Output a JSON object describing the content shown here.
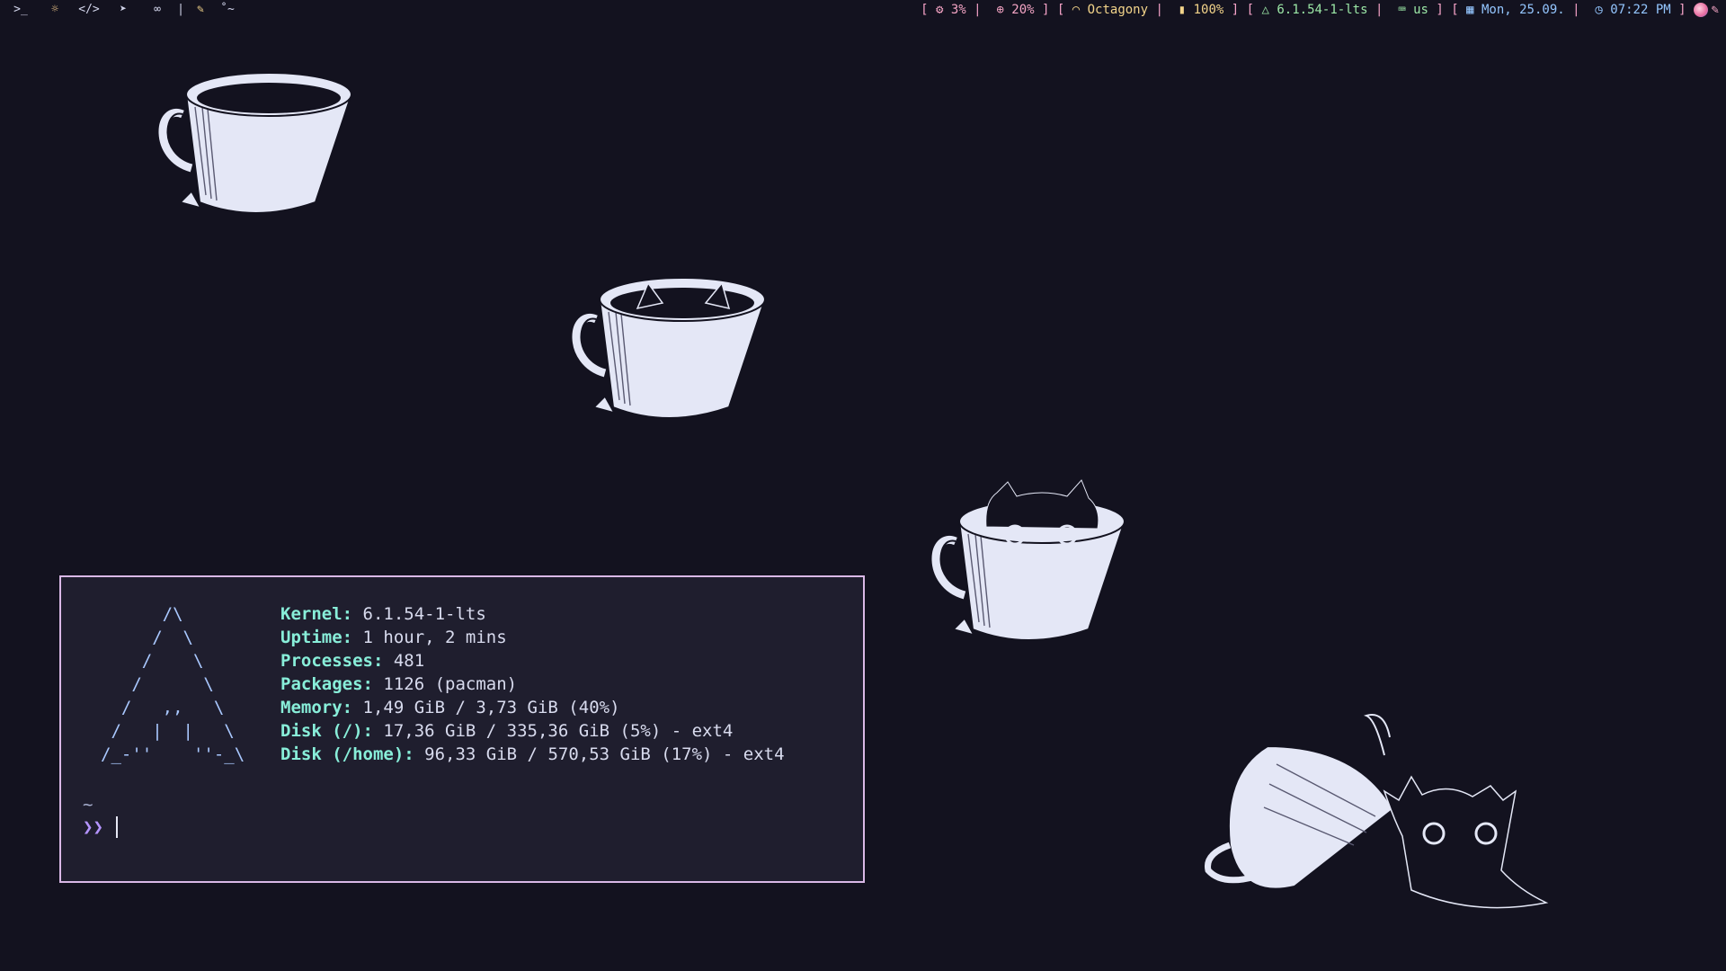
{
  "topbar": {
    "workspaces": [
      {
        "icon": "terminal-icon",
        "glyph": ">_",
        "active": false
      },
      {
        "icon": "firefox-icon",
        "glyph": "☼",
        "active": true
      },
      {
        "icon": "code-icon",
        "glyph": "</>",
        "active": false
      },
      {
        "icon": "telegram-icon",
        "glyph": "➤",
        "active": false
      },
      {
        "icon": "gamepad-icon",
        "glyph": "∞",
        "active": false
      }
    ],
    "divider": "|",
    "pen_glyph": "✎",
    "tilde_glyph": "˚~",
    "cpu": "3%",
    "memory": "20%",
    "wifi": "Octagony",
    "battery": "100%",
    "kernel": "6.1.54-1-lts",
    "keyboard": "us",
    "date": "Mon, 25.09.",
    "time": "07:22 PM"
  },
  "terminal": {
    "logo": "      /\\\n     /  \\\n    /    \\\n   /      \\\n  /   ,,   \\\n /   |  |   \\\n/_-''    ''-_\\",
    "info": [
      {
        "key": "Kernel",
        "value": "6.1.54-1-lts"
      },
      {
        "key": "Uptime",
        "value": "1 hour, 2 mins"
      },
      {
        "key": "Processes",
        "value": "481"
      },
      {
        "key": "Packages",
        "value": "1126 (pacman)"
      },
      {
        "key": "Memory",
        "value": "1,49 GiB / 3,73 GiB (40%)"
      },
      {
        "key": "Disk (/)",
        "value": "17,36 GiB / 335,36 GiB (5%) - ext4"
      },
      {
        "key": "Disk (/home)",
        "value": "96,33 GiB / 570,53 GiB (17%) - ext4"
      }
    ],
    "cwd": "~",
    "prompt": "❯❯"
  },
  "colors": {
    "background": "#13121f",
    "terminal_bg": "#1f1e2e",
    "terminal_border": "#d9b8e6",
    "info_key": "#88eed9",
    "cup": "#e4e7f6",
    "ink": "#13121f"
  },
  "wallpaper": {
    "items": [
      "empty-coffee-cup",
      "cup-with-cat-ears",
      "cat-peeking-from-cup",
      "cat-with-tipped-cup"
    ]
  }
}
